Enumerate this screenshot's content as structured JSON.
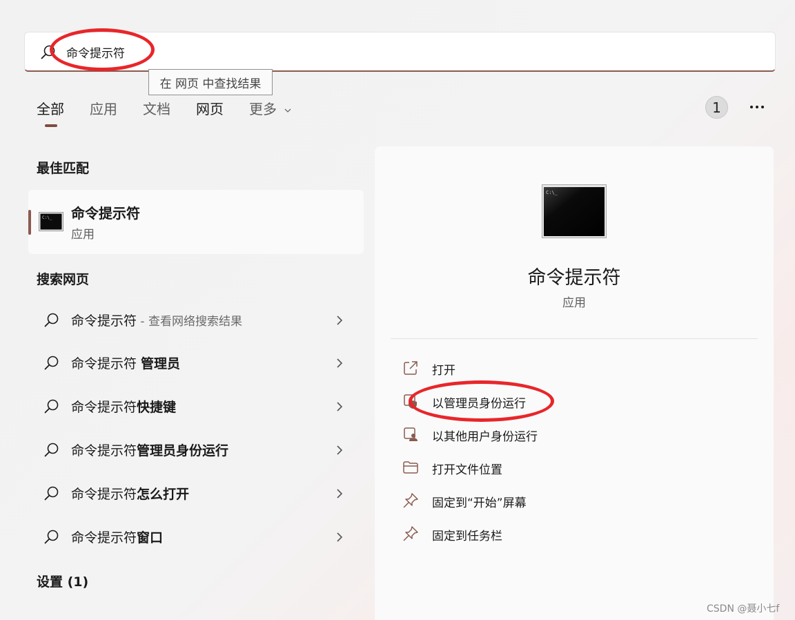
{
  "search": {
    "value": "命令提示符",
    "tooltip": "在 网页 中查找结果"
  },
  "tabs": [
    {
      "label": "全部",
      "active": true
    },
    {
      "label": "应用"
    },
    {
      "label": "文档"
    },
    {
      "label": "网页"
    },
    {
      "label": "更多"
    }
  ],
  "header": {
    "badge_count": "1"
  },
  "best_match": {
    "title": "最佳匹配",
    "name": "命令提示符",
    "type": "应用"
  },
  "search_web": {
    "title": "搜索网页",
    "items": [
      {
        "prefix": "命令提示符",
        "suffix": "",
        "sub": " - 查看网络搜索结果"
      },
      {
        "prefix": "命令提示符 ",
        "suffix": "管理员",
        "sub": ""
      },
      {
        "prefix": "命令提示符",
        "suffix": "快捷键",
        "sub": ""
      },
      {
        "prefix": "命令提示符",
        "suffix": "管理员身份运行",
        "sub": ""
      },
      {
        "prefix": "命令提示符",
        "suffix": "怎么打开",
        "sub": ""
      },
      {
        "prefix": "命令提示符",
        "suffix": "窗口",
        "sub": ""
      }
    ]
  },
  "settings": {
    "title": "设置 (1)"
  },
  "detail": {
    "name": "命令提示符",
    "type": "应用",
    "actions": [
      {
        "label": "打开",
        "icon": "open-external-icon"
      },
      {
        "label": "以管理员身份运行",
        "icon": "run-as-admin-icon"
      },
      {
        "label": "以其他用户身份运行",
        "icon": "run-as-other-user-icon"
      },
      {
        "label": "打开文件位置",
        "icon": "folder-icon"
      },
      {
        "label": "固定到“开始”屏幕",
        "icon": "pin-icon"
      },
      {
        "label": "固定到任务栏",
        "icon": "pin-icon"
      }
    ]
  },
  "watermark": "CSDN @聂小七f",
  "colors": {
    "accent": "#7f4c40",
    "annotation": "#e8262a"
  }
}
